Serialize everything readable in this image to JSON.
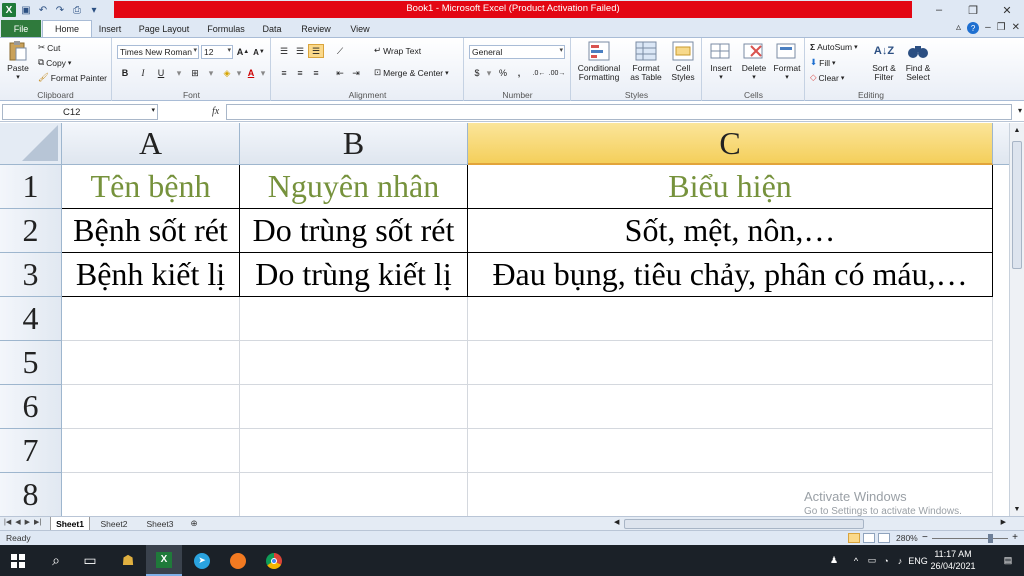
{
  "window": {
    "title": "Book1 - Microsoft Excel (Product Activation Failed)",
    "controls": {
      "minimize": "–",
      "restore": "❐",
      "close": "✕"
    }
  },
  "ribbon_tabs": [
    "File",
    "Home",
    "Insert",
    "Page Layout",
    "Formulas",
    "Data",
    "Review",
    "View"
  ],
  "ribbon": {
    "clipboard": {
      "label": "Clipboard",
      "paste": "Paste",
      "cut": "Cut",
      "copy": "Copy",
      "format_painter": "Format Painter"
    },
    "font": {
      "label": "Font",
      "family": "Times New Roman",
      "size": "12",
      "bold": "B",
      "italic": "I",
      "underline": "U"
    },
    "alignment": {
      "label": "Alignment",
      "wrap_text": "Wrap Text",
      "merge_center": "Merge & Center"
    },
    "number": {
      "label": "Number",
      "format": "General",
      "currency": "$",
      "percent": "%",
      "comma": ","
    },
    "styles": {
      "label": "Styles",
      "conditional_formatting": [
        "Conditional",
        "Formatting"
      ],
      "format_as_table": [
        "Format",
        "as Table"
      ],
      "cell_styles": [
        "Cell",
        "Styles"
      ]
    },
    "cells": {
      "label": "Cells",
      "insert": "Insert",
      "delete": "Delete",
      "format": "Format"
    },
    "editing": {
      "label": "Editing",
      "autosum": "AutoSum",
      "fill": "Fill",
      "clear": "Clear",
      "sort_filter": [
        "Sort &",
        "Filter"
      ],
      "find_select": [
        "Find &",
        "Select"
      ]
    }
  },
  "formula_bar": {
    "name_box": "C12",
    "fx": "fx",
    "value": ""
  },
  "grid": {
    "columns": [
      "A",
      "B",
      "C"
    ],
    "selected_column": "C",
    "rows": [
      "1",
      "2",
      "3",
      "4",
      "5",
      "6",
      "7",
      "8"
    ],
    "cells": {
      "A1": "Tên bệnh",
      "B1": "Nguyên nhân",
      "C1": "Biểu hiện",
      "A2": "Bệnh sốt rét",
      "B2": "Do trùng sốt rét",
      "C2": "Sốt, mệt, nôn,…",
      "A3": "Bệnh kiết lị",
      "B3": "Do trùng kiết lị",
      "C3": "Đau bụng, tiêu chảy, phân có máu,…"
    },
    "header_color": "#76923c"
  },
  "sheets": [
    "Sheet1",
    "Sheet2",
    "Sheet3"
  ],
  "active_sheet": "Sheet1",
  "status": {
    "text": "Ready",
    "zoom": "280%"
  },
  "watermark": {
    "title": "Activate Windows",
    "subtitle": "Go to Settings to activate Windows."
  },
  "taskbar": {
    "lang": "ENG",
    "time": "11:17 AM",
    "date": "26/04/2021"
  }
}
